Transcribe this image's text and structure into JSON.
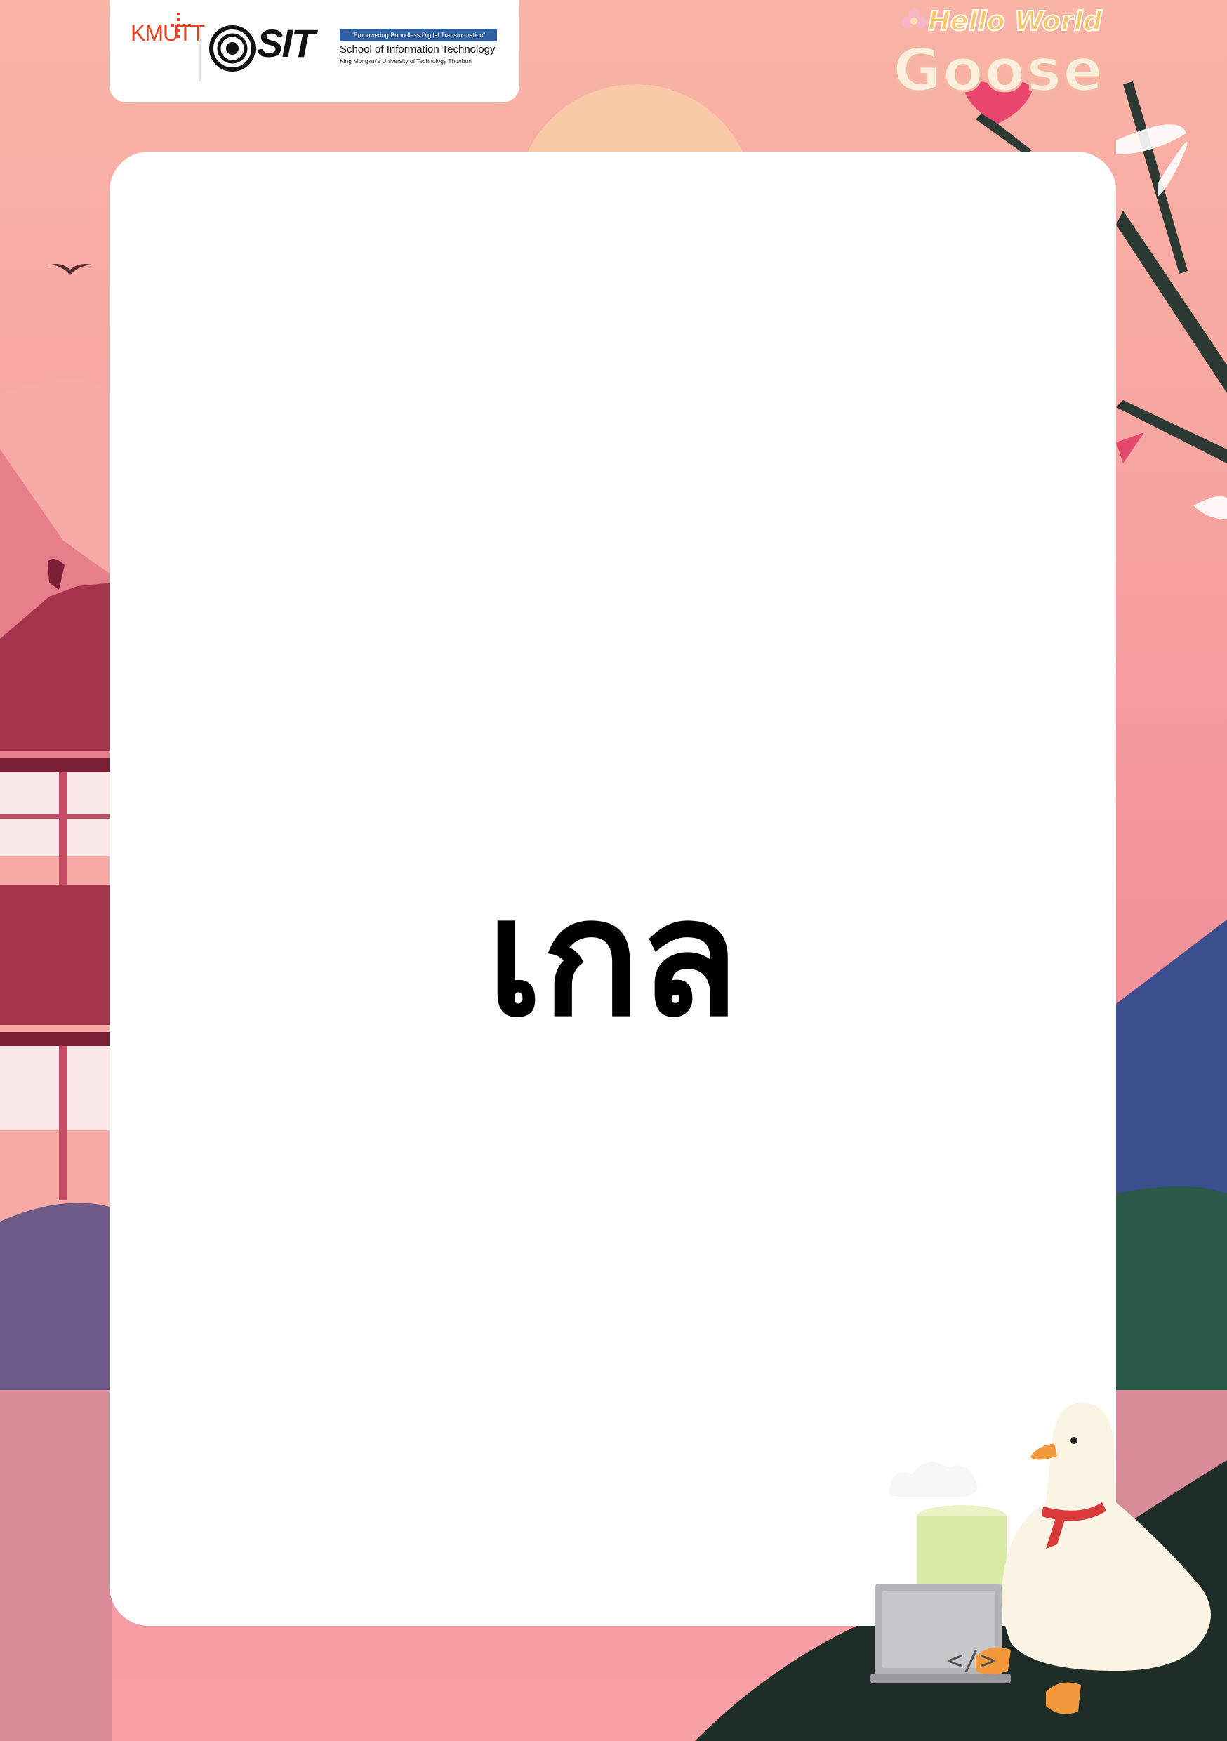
{
  "header": {
    "kmutt_logo_text": "KMUTT",
    "sit_wordmark": "SIT",
    "sit_tagline": "\"Empowering Boundless Digital Transformation\"",
    "sit_school_name": "School of Information Technology",
    "sit_university_name": "King Mongkut's University of Technology Thonburi"
  },
  "event_logo": {
    "line1": "Hello World",
    "line2": "Goose"
  },
  "card": {
    "word": "เกล"
  },
  "illustration": {
    "laptop_code": "</>"
  },
  "colors": {
    "background_top": "#f9b4a6",
    "background_bottom": "#f296a1",
    "card": "#ffffff",
    "word_text": "#000000",
    "kmutt_orange": "#e2431d",
    "sit_blue": "#2f5fa1"
  }
}
